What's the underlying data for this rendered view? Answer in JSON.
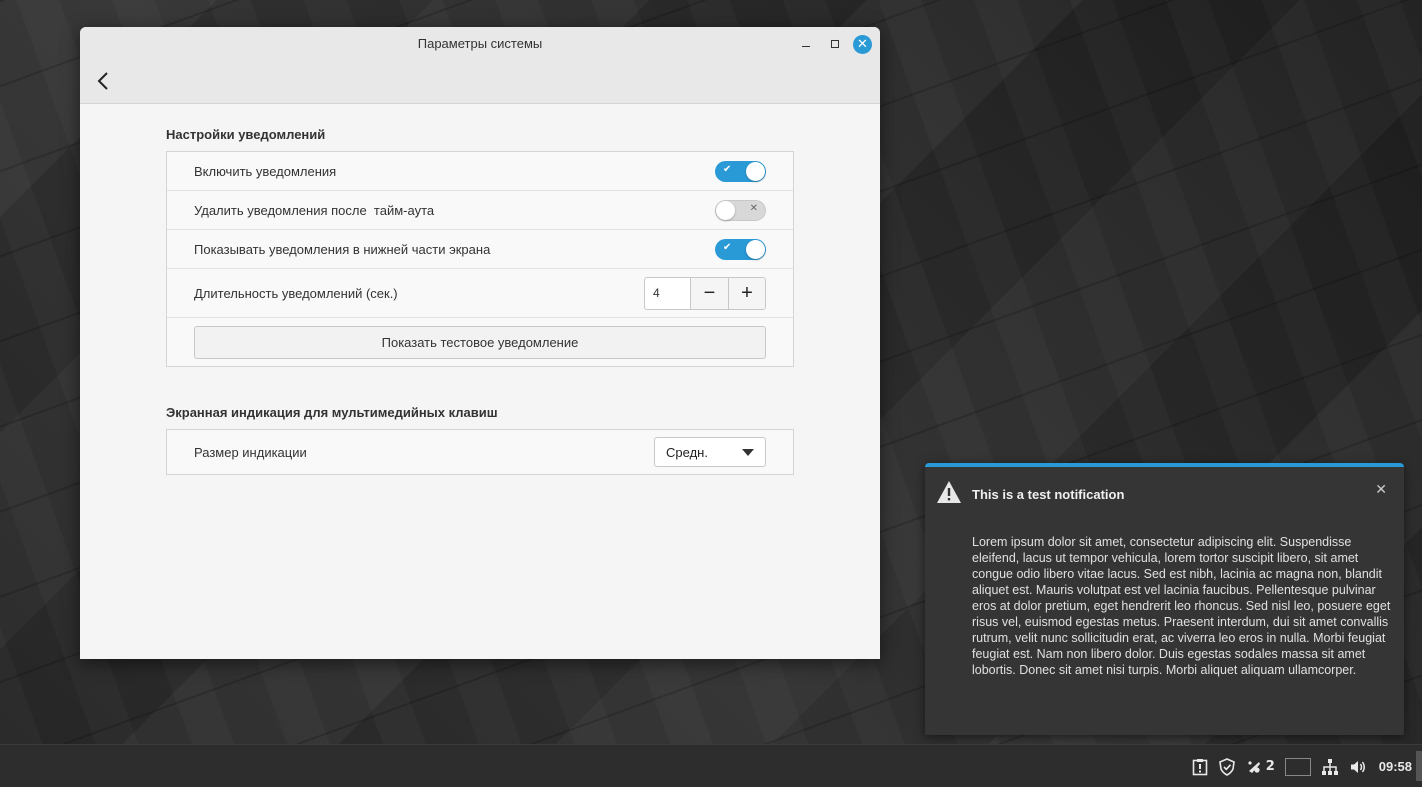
{
  "window": {
    "title": "Параметры системы",
    "controls": {
      "minimize": "minimize",
      "maximize": "maximize",
      "close": "✕"
    }
  },
  "notifications_section": {
    "title": "Настройки уведомлений",
    "rows": [
      {
        "label": "Включить уведомления",
        "state": "on"
      },
      {
        "label": "Удалить уведомления после  тайм-аута",
        "state": "off"
      },
      {
        "label": "Показывать уведомления в нижней части экрана",
        "state": "on"
      }
    ],
    "duration": {
      "label": "Длительность уведомлений (сек.)",
      "value": "4",
      "minus": "−",
      "plus": "+"
    },
    "test_button": "Показать тестовое уведомление"
  },
  "osd_section": {
    "title": "Экранная индикация для мультимедийных клавиш",
    "size": {
      "label": "Размер индикации",
      "selected": "Средн."
    }
  },
  "notification_popup": {
    "title": "This is a test notification",
    "body": "Lorem ipsum dolor sit amet, consectetur adipiscing elit. Suspendisse eleifend, lacus ut tempor vehicula, lorem tortor suscipit libero, sit amet congue odio libero vitae lacus. Sed est nibh, lacinia ac magna non, blandit aliquet est. Mauris volutpat est vel lacinia faucibus. Pellentesque pulvinar eros at dolor pretium, eget hendrerit leo rhoncus. Sed nisl leo, posuere eget risus vel, euismod egestas metus. Praesent interdum, dui sit amet convallis rutrum, velit nunc sollicitudin erat, ac viverra leo eros in nulla. Morbi feugiat feugiat est. Nam non libero dolor. Duis egestas sodales massa sit amet lobortis. Donec sit amet nisi turpis. Morbi aliquet aliquam ullamcorper.",
    "close": "✕",
    "icon": "warning-icon"
  },
  "taskbar": {
    "notification_count": "2",
    "clock": "09:58",
    "icons": [
      "clipboard-icon",
      "shield-icon",
      "notifications-icon",
      "flag-ru-icon",
      "network-icon",
      "volume-icon"
    ]
  },
  "colors": {
    "accent": "#2a9ad6",
    "window_bg": "#f5f5f5",
    "notif_bg": "#353535",
    "taskbar_bg": "#2d2d2d"
  }
}
